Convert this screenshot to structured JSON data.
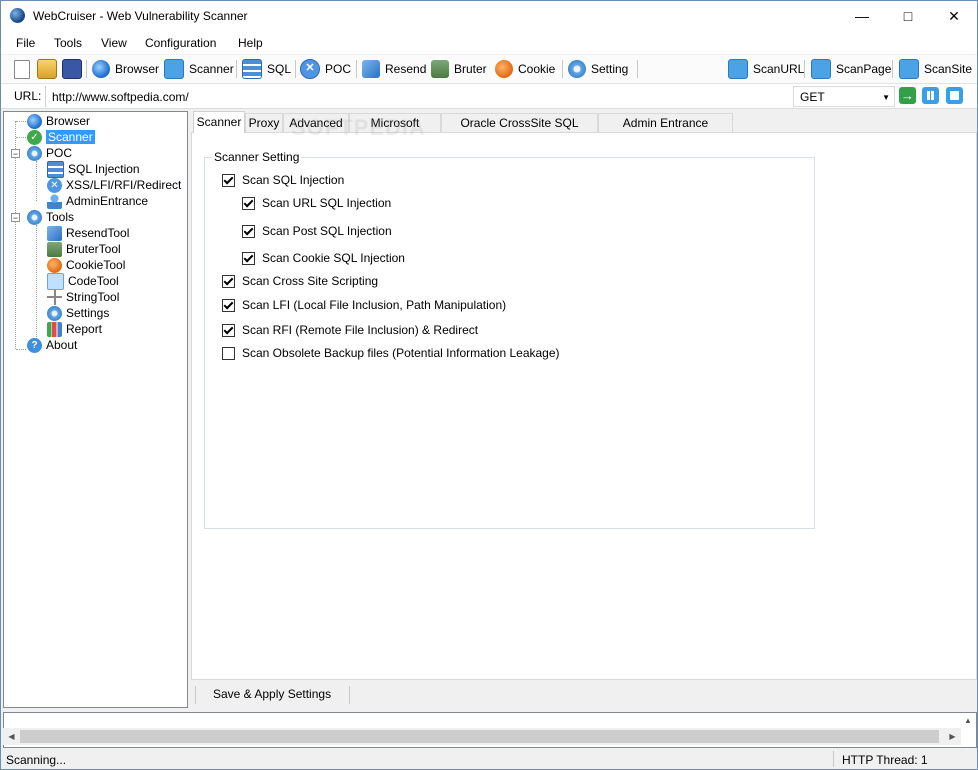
{
  "window": {
    "title": "WebCruiser - Web Vulnerability Scanner"
  },
  "menu": [
    "File",
    "Tools",
    "View",
    "Configuration",
    "Help"
  ],
  "toolbar": {
    "browser": "Browser",
    "scanner": "Scanner",
    "sql": "SQL",
    "poc": "POC",
    "resend": "Resend",
    "bruter": "Bruter",
    "cookie": "Cookie",
    "setting": "Setting",
    "scan_url": "ScanURL",
    "scan_page": "ScanPage",
    "scan_site": "ScanSite"
  },
  "urlbar": {
    "label": "URL:",
    "value": "http://www.softpedia.com/",
    "method": "GET"
  },
  "tree": {
    "browser": "Browser",
    "scanner": "Scanner",
    "poc": "POC",
    "sql_injection": "SQL Injection",
    "xss": "XSS/LFI/RFI/Redirect",
    "admin_entrance": "AdminEntrance",
    "tools": "Tools",
    "resend_tool": "ResendTool",
    "bruter_tool": "BruterTool",
    "cookie_tool": "CookieTool",
    "code_tool": "CodeTool",
    "string_tool": "StringTool",
    "settings": "Settings",
    "report": "Report",
    "about": "About"
  },
  "tabs": [
    "Scanner",
    "Proxy",
    "Advanced",
    "Microsoft Access",
    "Oracle CrossSite SQL Injection",
    "Admin Entrance Dictionary"
  ],
  "scanner_settings": {
    "group_title": "Scanner Setting",
    "options": [
      {
        "label": "Scan SQL Injection",
        "checked": true
      },
      {
        "label": "Scan URL SQL Injection",
        "checked": true
      },
      {
        "label": "Scan Post SQL Injection",
        "checked": true
      },
      {
        "label": "Scan Cookie SQL Injection",
        "checked": true
      },
      {
        "label": "Scan Cross Site Scripting",
        "checked": true
      },
      {
        "label": "Scan LFI (Local File Inclusion, Path Manipulation)",
        "checked": true
      },
      {
        "label": "Scan RFI (Remote File Inclusion) & Redirect",
        "checked": true
      },
      {
        "label": "Scan Obsolete Backup files (Potential Information Leakage)",
        "checked": false
      }
    ],
    "apply_label": "Save & Apply Settings"
  },
  "status": {
    "left": "Scanning...",
    "right": "HTTP Thread: 1"
  },
  "watermark": "SOFTPEDIA"
}
